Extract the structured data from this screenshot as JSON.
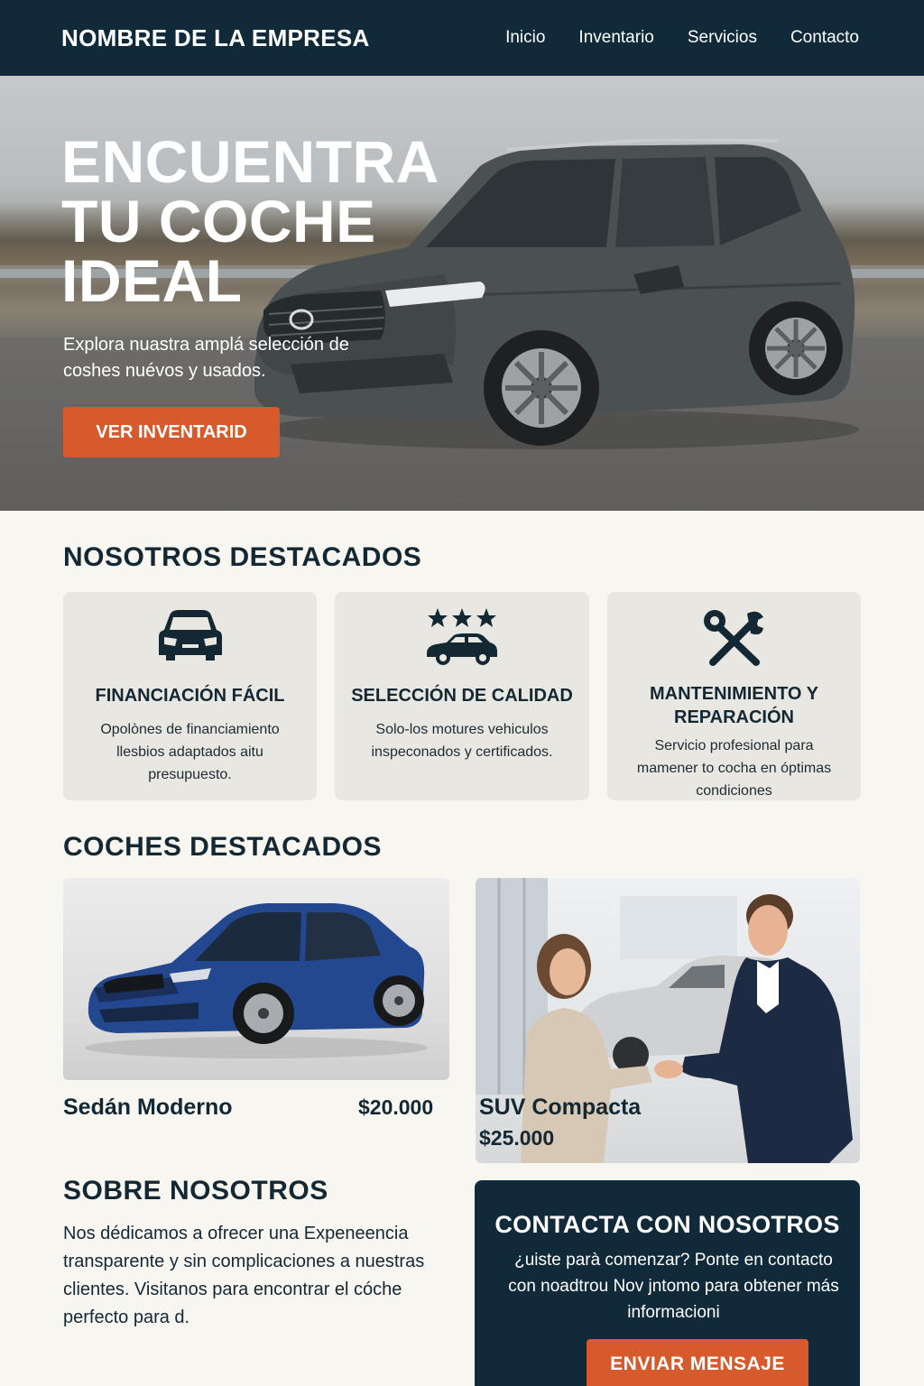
{
  "header": {
    "brand": "NOMBRE DE LA EMPRESA",
    "nav": [
      "Inicio",
      "Inventario",
      "Servicios",
      "Contacto"
    ]
  },
  "hero": {
    "title_lines": [
      "ENCUENTRA",
      "TU COCHE",
      "IDEAL"
    ],
    "subtitle": "Explora nuastra amplá selección de coshes nuévos y usados.",
    "cta": "VER INVENTARID"
  },
  "features": {
    "title": "NOSOTROS DESTACADOS",
    "cards": [
      {
        "icon": "car-front-icon",
        "title": "FINANCIACIÓN FÁCIL",
        "text": "Opolònes de financiamiento llesbios adaptados aitu presupuesto."
      },
      {
        "icon": "rated-car-icon",
        "title": "SELECCIÓN DE CALIDAD",
        "text": "Solo-los motures vehiculos inspeconados y certificados."
      },
      {
        "icon": "tools-icon",
        "title": "MANTENIMIENTO Y REPARACIÓN",
        "text": "Servicio profesional para mamener to cocha en óptimas condiciones"
      }
    ]
  },
  "featured_cars": {
    "title": "COCHES DESTACADOS",
    "items": [
      {
        "name": "Sedán Moderno",
        "price": "$20.000"
      },
      {
        "name": "SUV Compacta",
        "price": "$25.000"
      }
    ]
  },
  "about": {
    "title": "SOBRE NOSOTROS",
    "text": "Nos dédicamos a ofrecer una Expeneencia transparente y sin complicaciones a nuestras clientes. Visitanos para encontrar el cóche perfecto para d."
  },
  "contact": {
    "title": "CONTACTA CON NOSOTROS",
    "text": "¿uiste parà comenzar? Ponte en contacto con noadtrou Nov jntomo para obtener más informacioni",
    "button": "ENVIAR MENSAJE"
  },
  "colors": {
    "navy": "#112a3a",
    "accent": "#d65a2c",
    "background": "#f8f6f1",
    "card": "#e9e7e2"
  }
}
